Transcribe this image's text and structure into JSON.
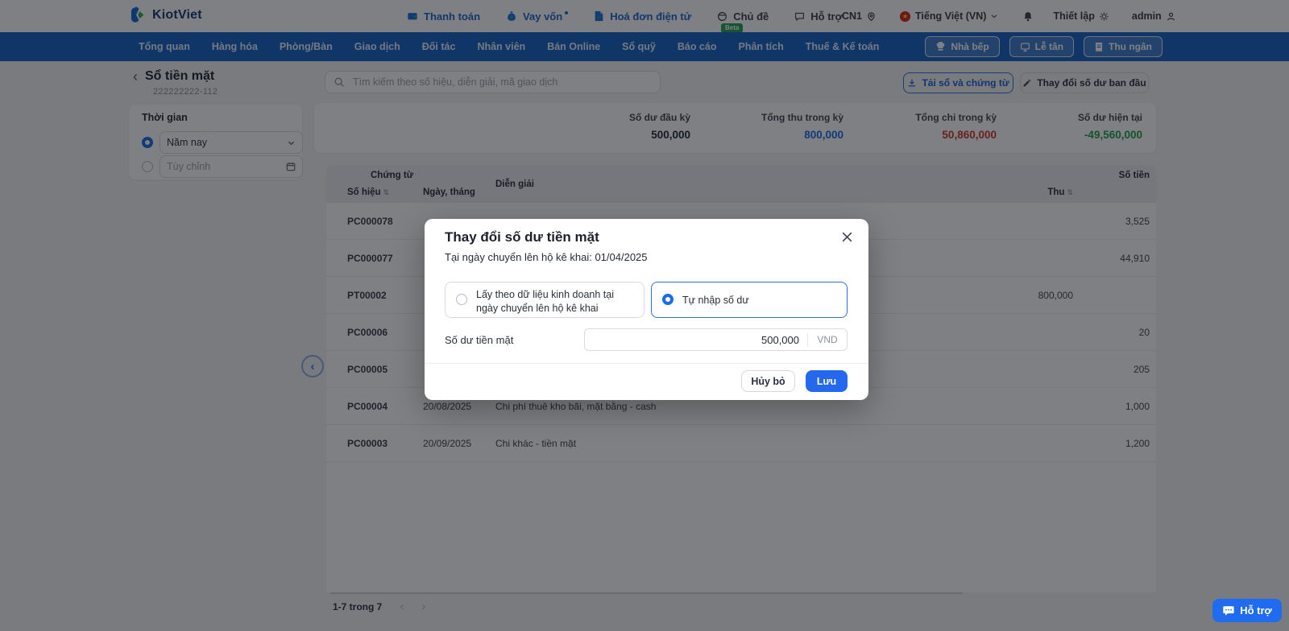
{
  "header": {
    "brand": "KiotViet",
    "menu": [
      {
        "label": "Thanh toán"
      },
      {
        "label": "Vay vốn"
      },
      {
        "label": "Hoá đơn điện tử"
      },
      {
        "label": "Chủ đề"
      },
      {
        "label": "Hỗ trợ"
      }
    ],
    "beta_badge": "Beta",
    "branch": "CN1",
    "language": "Tiếng Việt (VN)",
    "settings_label": "Thiết lập",
    "user": "admin"
  },
  "nav": {
    "items": [
      {
        "label": "Tổng quan"
      },
      {
        "label": "Hàng hóa"
      },
      {
        "label": "Phòng/Bàn"
      },
      {
        "label": "Giao dịch"
      },
      {
        "label": "Đối tác"
      },
      {
        "label": "Nhân viên"
      },
      {
        "label": "Bán Online"
      },
      {
        "label": "Sổ quỹ"
      },
      {
        "label": "Báo cáo"
      },
      {
        "label": "Phân tích"
      },
      {
        "label": "Thuế & Kế toán"
      }
    ],
    "actions": [
      {
        "label": "Nhà bếp"
      },
      {
        "label": "Lễ tân"
      },
      {
        "label": "Thu ngân"
      }
    ]
  },
  "sidebar": {
    "title": "Sổ tiền mặt",
    "subtitle": "222222222-112",
    "filter_title": "Thời gian",
    "time_preset": "Năm nay",
    "time_custom_placeholder": "Tùy chỉnh"
  },
  "toolbar": {
    "search_placeholder": "Tìm kiếm theo số hiệu, diễn giải, mã giao dịch",
    "download_label": "Tải sổ và chứng từ",
    "change_opening_label": "Thay đổi số dư ban đầu"
  },
  "summary": {
    "opening": {
      "label": "Số dư đầu kỳ",
      "value": "500,000"
    },
    "total_in": {
      "label": "Tổng thu trong kỳ",
      "value": "800,000"
    },
    "total_out": {
      "label": "Tổng chi trong kỳ",
      "value": "50,860,000"
    },
    "current": {
      "label": "Số dư hiện tại",
      "value": "-49,560,000"
    }
  },
  "colors": {
    "accent": "#1a6be8",
    "income": "#1a6be8",
    "expense": "#d0342c",
    "balance": "#1f9e47"
  },
  "table": {
    "group_voucher": "Chứng từ",
    "group_amount": "Số tiền",
    "col_code": "Số hiệu",
    "col_date": "Ngày, tháng",
    "col_desc": "Diễn giải",
    "col_in": "Thu",
    "rows": [
      {
        "code": "PC000078",
        "date": "",
        "desc": "",
        "thu": "",
        "chi": "3,525"
      },
      {
        "code": "PC000077",
        "date": "",
        "desc": "",
        "thu": "",
        "chi": "44,910"
      },
      {
        "code": "PT00002",
        "date": "",
        "desc": "",
        "thu": "800,000",
        "chi": ""
      },
      {
        "code": "PC00006",
        "date": "",
        "desc": "",
        "thu": "",
        "chi": "20"
      },
      {
        "code": "PC00005",
        "date": "",
        "desc": "",
        "thu": "",
        "chi": "205"
      },
      {
        "code": "PC00004",
        "date": "20/08/2025",
        "desc": "Chi phí thuê kho bãi, mặt bằng - cash",
        "thu": "",
        "chi": "1,000"
      },
      {
        "code": "PC00003",
        "date": "20/09/2025",
        "desc": "Chi khác - tiền mặt",
        "thu": "",
        "chi": "1,200"
      }
    ],
    "pagination": "1-7 trong 7"
  },
  "modal": {
    "title": "Thay đổi số dư tiền mặt",
    "subtitle": "Tại ngày chuyển lên hộ kê khai: 01/04/2025",
    "option_business": "Lấy theo dữ liệu kinh doanh tại ngày chuyển lên hộ kê khai",
    "option_manual": "Tự nhập số dư",
    "field_label": "Số dư tiền mặt",
    "field_value": "500,000",
    "field_unit": "VND",
    "cancel_label": "Hủy bỏ",
    "save_label": "Lưu"
  },
  "support_label": "Hỗ trợ",
  "icons": {
    "back": "‹",
    "sort": "⇅",
    "page_prev": "‹",
    "page_next": "›"
  }
}
